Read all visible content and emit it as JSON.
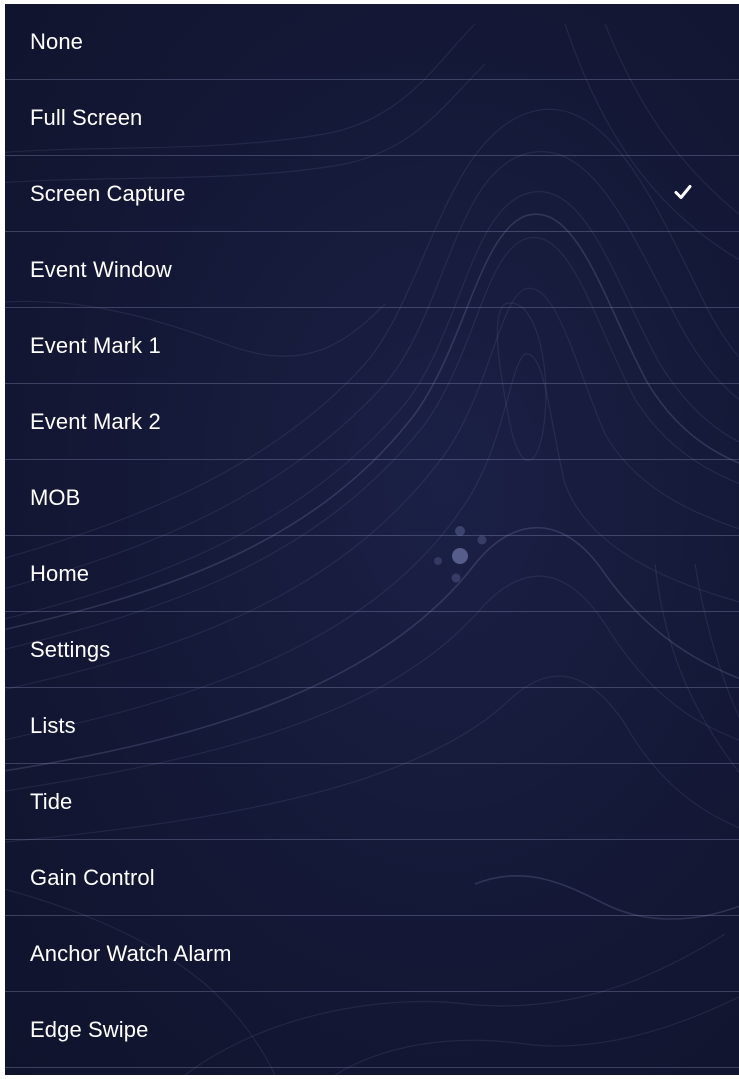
{
  "menu": {
    "items": [
      {
        "label": "None",
        "checked": false
      },
      {
        "label": "Full Screen",
        "checked": false
      },
      {
        "label": "Screen Capture",
        "checked": true
      },
      {
        "label": "Event Window",
        "checked": false
      },
      {
        "label": "Event Mark 1",
        "checked": false
      },
      {
        "label": "Event Mark 2",
        "checked": false
      },
      {
        "label": "MOB",
        "checked": false
      },
      {
        "label": "Home",
        "checked": false
      },
      {
        "label": "Settings",
        "checked": false
      },
      {
        "label": "Lists",
        "checked": false
      },
      {
        "label": "Tide",
        "checked": false
      },
      {
        "label": "Gain Control",
        "checked": false
      },
      {
        "label": "Anchor Watch Alarm",
        "checked": false
      },
      {
        "label": "Edge Swipe",
        "checked": false
      }
    ],
    "check_icon": "checkmark-icon"
  },
  "colors": {
    "background": "#141836",
    "text": "#ffffff",
    "divider": "#5a6080"
  }
}
